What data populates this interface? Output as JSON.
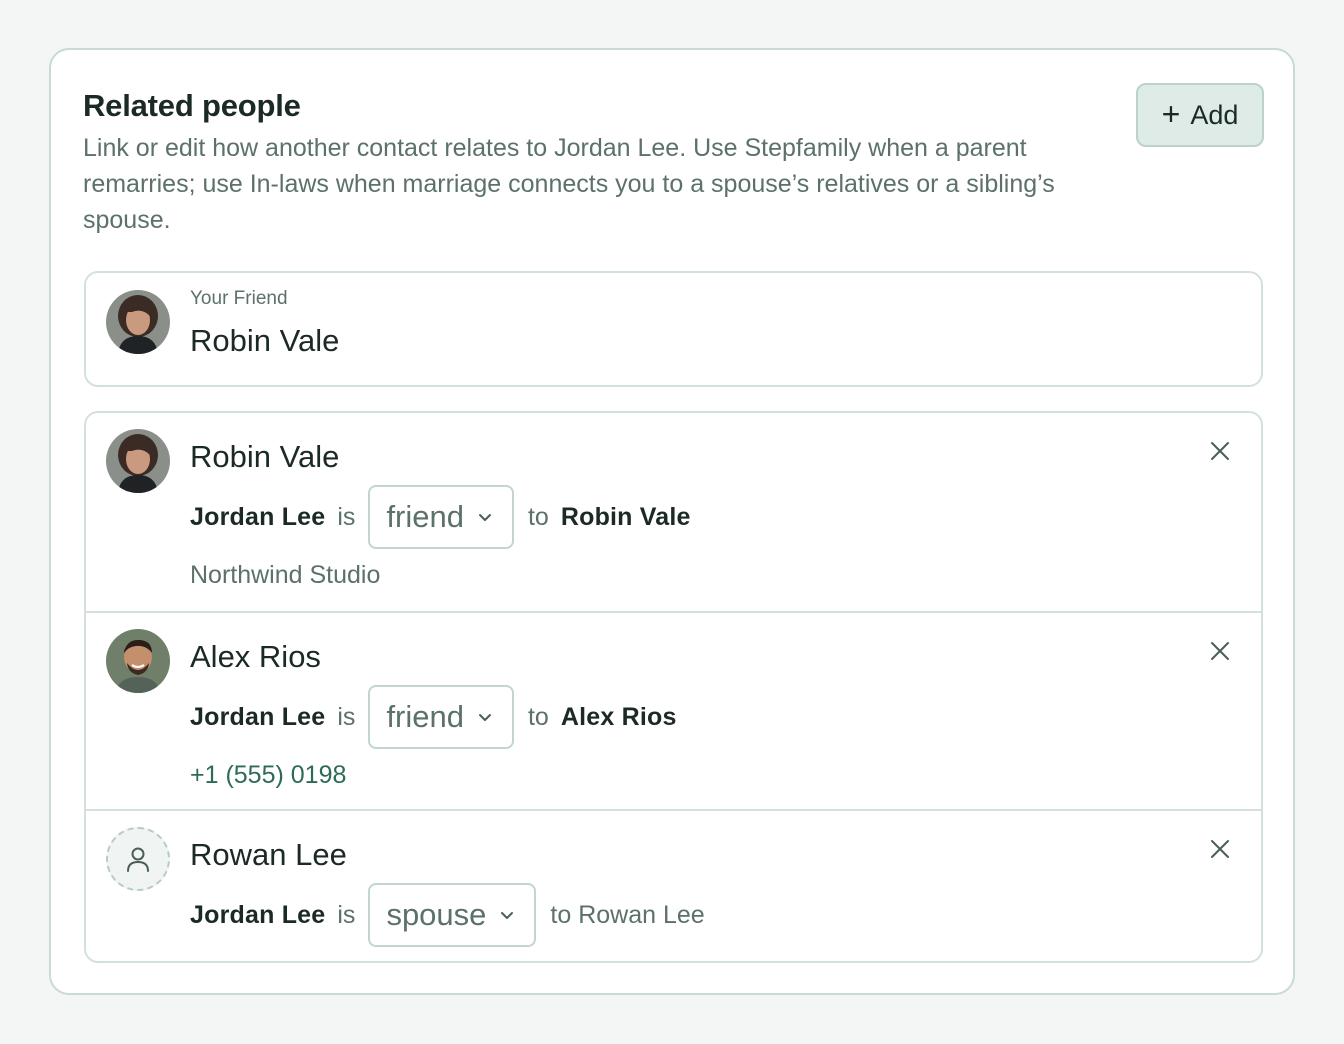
{
  "header": {
    "title": "Related people",
    "description": "Link or edit how another contact relates to Jordan Lee. Use Stepfamily when a parent remarries; use In-laws when marriage connects you to a spouse’s relatives or a sibling’s spouse.",
    "add_button_icon": "plus-icon",
    "add_button_label": "Add"
  },
  "primary": {
    "eyebrow": "Your Friend",
    "name": "Robin Vale"
  },
  "rows": [
    {
      "name": "Robin Vale",
      "subject": "Jordan Lee",
      "is_label": "is",
      "relation": "friend",
      "to_label": "to",
      "target": "Robin Vale",
      "detail": "Northwind Studio",
      "detail_color": "#5b716a"
    },
    {
      "name": "Alex Rios",
      "subject": "Jordan Lee",
      "is_label": "is",
      "relation": "friend",
      "to_label": "to",
      "target": "Alex Rios",
      "detail": "+1 (555) 0198",
      "detail_color": "#2e6b55"
    },
    {
      "name": "Rowan Lee",
      "subject": "Jordan Lee",
      "is_label": "is",
      "relation": "spouse",
      "to_text": "to Rowan Lee"
    }
  ],
  "colors": {
    "accent": "#2e6b55",
    "muted_text": "#5b716a",
    "border": "#d3e1dc",
    "add_button_bg": "#dfebe6"
  }
}
